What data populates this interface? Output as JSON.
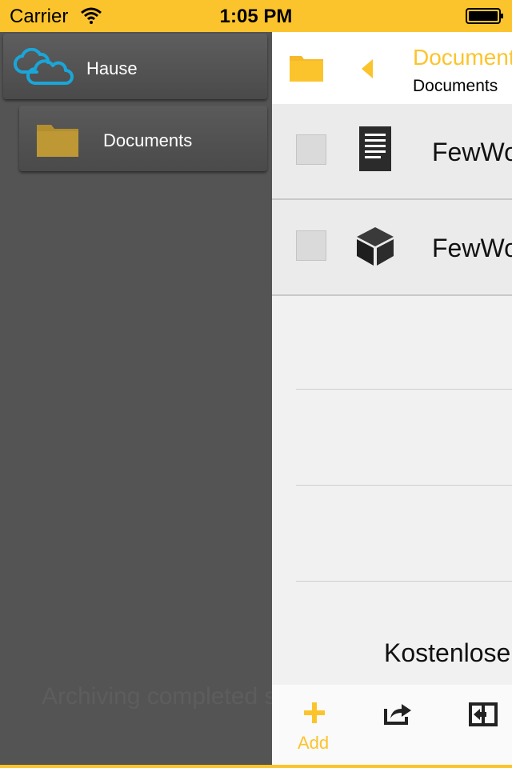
{
  "status_bar": {
    "carrier": "Carrier",
    "time": "1:05 PM"
  },
  "sidebar": {
    "account": {
      "label": "Hause",
      "icon": "cloud-icon",
      "color": "#1aa6d9"
    },
    "folder": {
      "label": "Documents",
      "icon": "folder-icon",
      "color": "#b38f2f"
    },
    "status_message": "Archiving completed successfully"
  },
  "header": {
    "title": "Documents",
    "subtitle": "Documents"
  },
  "files": [
    {
      "name": "FewWords",
      "icon": "document-icon",
      "checked": false
    },
    {
      "name": "FewWords",
      "icon": "box-icon",
      "checked": false
    }
  ],
  "promo_text": "Kostenlose",
  "toolbar": {
    "add_label": "Add"
  },
  "colors": {
    "accent": "#fcc42c",
    "sidebar_bg": "#545454",
    "main_bg": "#f1f1f1"
  }
}
